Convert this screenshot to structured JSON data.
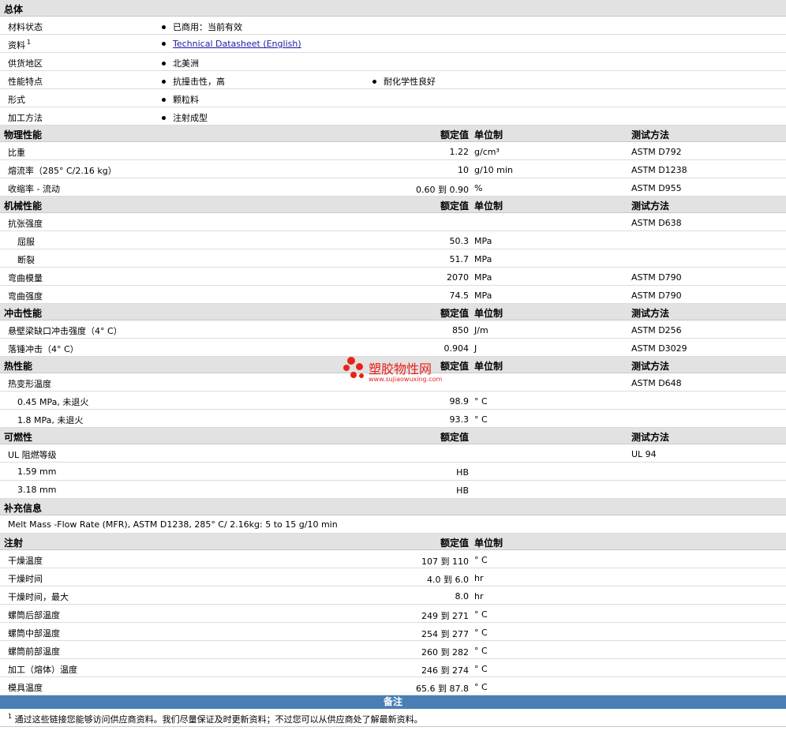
{
  "general": {
    "title": "总体",
    "rows": [
      {
        "label": "材料状态",
        "bullets": [
          "已商用：当前有效"
        ]
      },
      {
        "label": "资料",
        "sup": "1",
        "link": "Technical Datasheet (English)"
      },
      {
        "label": "供货地区",
        "bullets": [
          "北美洲"
        ]
      },
      {
        "label": "性能特点",
        "bullets": [
          "抗撞击性，高",
          "耐化学性良好"
        ]
      },
      {
        "label": "形式",
        "bullets": [
          "颗粒料"
        ]
      },
      {
        "label": "加工方法",
        "bullets": [
          "注射成型"
        ]
      }
    ]
  },
  "headers": {
    "value": "额定值",
    "unit": "单位制",
    "test": "测试方法"
  },
  "physical": {
    "title": "物理性能",
    "rows": [
      {
        "label": "比重",
        "value": "1.22",
        "unit": "g/cm³",
        "test": "ASTM D792"
      },
      {
        "label": "熔流率（285° C/2.16 kg）",
        "value": "10",
        "unit": "g/10 min",
        "test": "ASTM D1238"
      },
      {
        "label": "收缩率 - 流动",
        "value": "0.60 到  0.90",
        "unit": "%",
        "test": "ASTM D955"
      }
    ]
  },
  "mechanical": {
    "title": "机械性能",
    "rows": [
      {
        "label": "抗张强度",
        "value": "",
        "unit": "",
        "test": "ASTM D638"
      },
      {
        "label": "屈服",
        "sub": true,
        "value": "50.3",
        "unit": "MPa",
        "test": ""
      },
      {
        "label": "断裂",
        "sub": true,
        "value": "51.7",
        "unit": "MPa",
        "test": ""
      },
      {
        "label": "弯曲模量",
        "value": "2070",
        "unit": "MPa",
        "test": "ASTM D790"
      },
      {
        "label": "弯曲强度",
        "value": "74.5",
        "unit": "MPa",
        "test": "ASTM D790"
      }
    ]
  },
  "impact": {
    "title": "冲击性能",
    "rows": [
      {
        "label": "悬壁梁缺口冲击强度（4° C）",
        "value": "850",
        "unit": "J/m",
        "test": "ASTM D256"
      },
      {
        "label": "落锤冲击（4° C）",
        "value": "0.904",
        "unit": "J",
        "test": "ASTM D3029"
      }
    ]
  },
  "thermal": {
    "title": "热性能",
    "rows": [
      {
        "label": "热变形温度",
        "value": "",
        "unit": "",
        "test": "ASTM D648"
      },
      {
        "label": "0.45 MPa, 未退火",
        "sub": true,
        "value": "98.9",
        "unit": "° C",
        "test": ""
      },
      {
        "label": "1.8 MPa, 未退火",
        "sub": true,
        "value": "93.3",
        "unit": "° C",
        "test": ""
      }
    ]
  },
  "flammability": {
    "title": "可燃性",
    "rows": [
      {
        "label": "UL 阻燃等级",
        "value": "",
        "unit": "",
        "test": "UL 94"
      },
      {
        "label": "1.59 mm",
        "sub": true,
        "value": "HB",
        "unit": "",
        "test": ""
      },
      {
        "label": "3.18 mm",
        "sub": true,
        "value": "HB",
        "unit": "",
        "test": ""
      }
    ]
  },
  "supplement": {
    "title": "补充信息",
    "text": "Melt Mass -Flow Rate (MFR), ASTM D1238, 285° C/ 2.16kg: 5 to 15 g/10 min"
  },
  "injection": {
    "title": "注射",
    "rows": [
      {
        "label": "干燥温度",
        "value": "107 到  110",
        "unit": "° C"
      },
      {
        "label": "干燥时间",
        "value": "4.0 到  6.0",
        "unit": "hr"
      },
      {
        "label": "干燥时间，最大",
        "value": "8.0",
        "unit": "hr"
      },
      {
        "label": "螺筒后部温度",
        "value": "249 到  271",
        "unit": "° C"
      },
      {
        "label": "螺筒中部温度",
        "value": "254 到  277",
        "unit": "° C"
      },
      {
        "label": "螺筒前部温度",
        "value": "260 到  282",
        "unit": "° C"
      },
      {
        "label": "加工（熔体）温度",
        "value": "246 到  274",
        "unit": "° C"
      },
      {
        "label": "模具温度",
        "value": "65.6 到  87.8",
        "unit": "° C"
      }
    ]
  },
  "notes": {
    "title": "备注",
    "sup": "1",
    "text": "通过这些链接您能够访问供应商资料。我们尽量保证及时更新资料；不过您可以从供应商处了解最新资料。"
  },
  "watermark": {
    "title": "塑胶物性网",
    "url": "www.sujiaowuxing.com",
    "color": "#e8221b"
  }
}
